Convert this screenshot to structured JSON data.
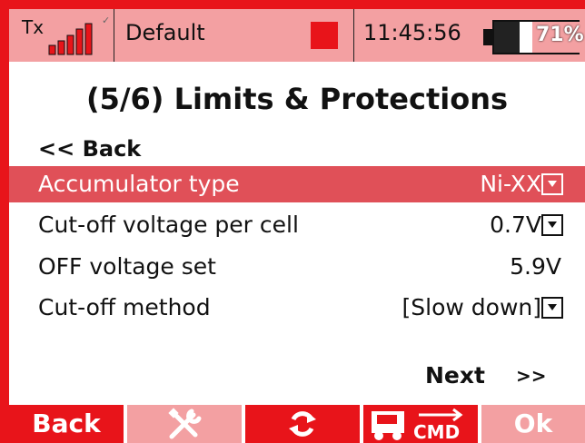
{
  "status_bar": {
    "tx_label": "Tx",
    "model_name": "Default",
    "time": "11:45:56",
    "battery_percent": "71%",
    "battery_level": 0.71,
    "signal_bars": 5,
    "colors": {
      "bar_bg": "#f3a0a2",
      "model_indicator": "#e8141a"
    }
  },
  "page": {
    "title": "(5/6) Limits & Protections",
    "back_label": "<< Back",
    "next_label": "Next",
    "next_arrows": ">>"
  },
  "settings": [
    {
      "label": "Accumulator type",
      "value": "Ni-XX",
      "dropdown": true,
      "selected": true
    },
    {
      "label": "Cut-off voltage per cell",
      "value": "0.7V",
      "dropdown": true,
      "selected": false
    },
    {
      "label": "OFF voltage set",
      "value": "5.9V",
      "dropdown": false,
      "selected": false
    },
    {
      "label": "Cut-off method",
      "value": "[Slow down]",
      "dropdown": true,
      "selected": false
    }
  ],
  "footer": {
    "back": "Back",
    "tools_icon": "wrench-screwdriver-icon",
    "refresh_icon": "refresh-icon",
    "cmd_icon": "vehicle-cmd-icon",
    "cmd_text": "CMD",
    "ok": "Ok"
  },
  "colors": {
    "accent": "#e8141a",
    "selected_row": "#e05058",
    "light_accent": "#f3a0a2"
  }
}
